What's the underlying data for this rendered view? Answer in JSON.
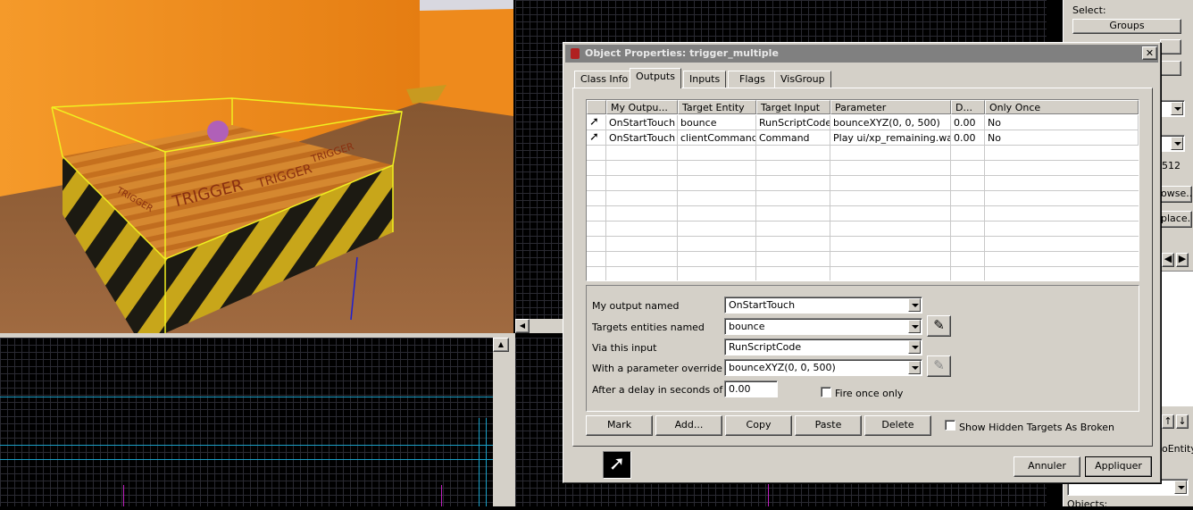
{
  "dialog": {
    "title": "Object Properties: trigger_multiple",
    "tabs": [
      "Class Info",
      "Outputs",
      "Inputs",
      "Flags",
      "VisGroup"
    ],
    "active_tab": "Outputs",
    "table": {
      "columns": [
        "My Outpu...",
        "Target Entity",
        "Target Input",
        "Parameter",
        "D...",
        "Only Once"
      ],
      "rows": [
        [
          "OnStartTouch",
          "bounce",
          "RunScriptCode",
          "bounceXYZ(0, 0, 500)",
          "0.00",
          "No"
        ],
        [
          "OnStartTouch",
          "clientCommands",
          "Command",
          "Play ui/xp_remaining.wav",
          "0.00",
          "No"
        ]
      ]
    },
    "form": {
      "output_label": "My output named",
      "output_value": "OnStartTouch",
      "targets_label": "Targets entities named",
      "targets_value": "bounce",
      "input_label": "Via this input",
      "input_value": "RunScriptCode",
      "param_label": "With a parameter override",
      "param_value": "bounceXYZ(0, 0, 500)",
      "delay_label": "After a delay in seconds of",
      "delay_value": "0.00",
      "fire_once_label": "Fire once only"
    },
    "buttons": {
      "mark": "Mark",
      "add": "Add...",
      "copy": "Copy",
      "paste": "Paste",
      "delete": "Delete",
      "show_hidden": "Show Hidden Targets As Broken",
      "cancel": "Annuler",
      "apply": "Appliquer"
    },
    "icons": {
      "close": "close-icon",
      "output": "output-arrow-icon",
      "eyedropper": "eyedropper-icon"
    }
  },
  "viewport3d": {
    "texture_labels": [
      "TRIGGER",
      "TRIGGER",
      "TRIGGER",
      "TRIGGER"
    ]
  },
  "right_panel": {
    "select_label": "Select:",
    "groups_button": "Groups",
    "number": "512",
    "browse_button": "owse...",
    "replace_button": "place...",
    "entity_label": "oEntity",
    "objects_label": "Objects:"
  },
  "colors": {
    "accent": "#0a246a",
    "trigger_orange": "#d2691e",
    "wall_orange": "#f08c1a"
  }
}
